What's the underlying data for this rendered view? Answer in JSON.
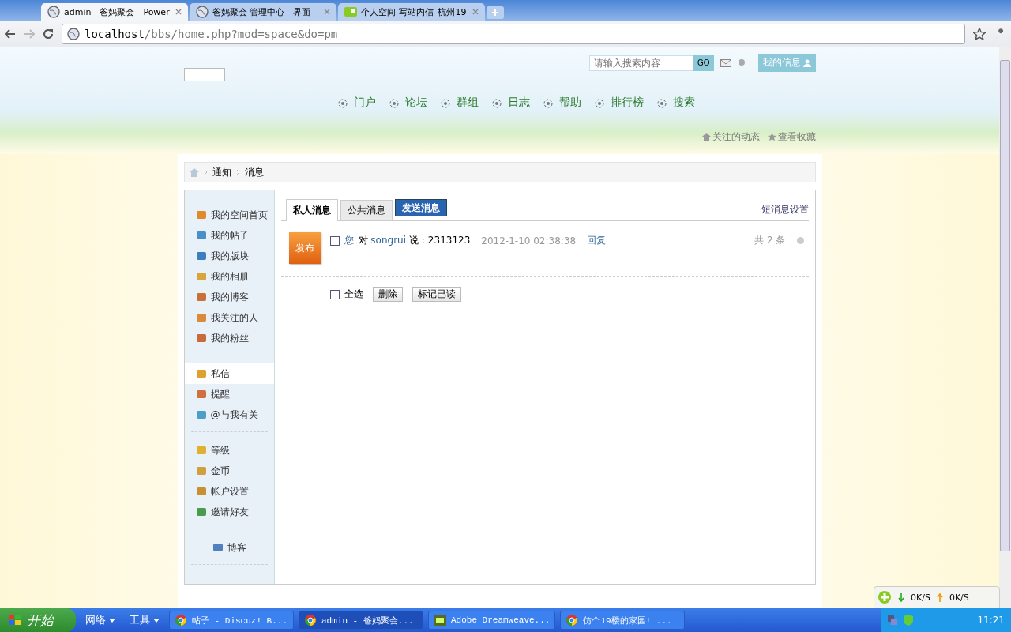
{
  "browser": {
    "tabs": [
      {
        "title": "admin - 爸妈聚会 - Power",
        "selected": true
      },
      {
        "title": "爸妈聚会 管理中心 - 界面",
        "selected": false
      },
      {
        "title": "个人空间-写站内信_杭州19",
        "selected": false
      }
    ],
    "url_host": "localhost",
    "url_path": "/bbs/home.php?mod=space&do=pm"
  },
  "header": {
    "search_placeholder": "请输入搜索内容",
    "go": "GO",
    "my_info": "我的信息",
    "nav": [
      "门户",
      "论坛",
      "群组",
      "日志",
      "帮助",
      "排行榜",
      "搜索"
    ],
    "links": [
      "关注的动态",
      "查看收藏"
    ]
  },
  "breadcrumb": [
    "通知",
    "消息"
  ],
  "sidebar": {
    "groups": [
      [
        {
          "label": "我的空间首页",
          "selected": false,
          "color": "#e08a2c"
        },
        {
          "label": "我的帖子",
          "selected": false,
          "color": "#4a90c8"
        },
        {
          "label": "我的版块",
          "selected": false,
          "color": "#3a7fc0"
        },
        {
          "label": "我的相册",
          "selected": false,
          "color": "#d9a53a"
        },
        {
          "label": "我的博客",
          "selected": false,
          "color": "#c8703a"
        },
        {
          "label": "我关注的人",
          "selected": false,
          "color": "#d98a3a"
        },
        {
          "label": "我的粉丝",
          "selected": false,
          "color": "#c86a3a"
        }
      ],
      [
        {
          "label": "私信",
          "selected": true,
          "color": "#e0a030"
        },
        {
          "label": "提醒",
          "selected": false,
          "color": "#d07040"
        },
        {
          "label": "@与我有关",
          "selected": false,
          "color": "#4aa0c8"
        }
      ],
      [
        {
          "label": "等级",
          "selected": false,
          "color": "#e0b030"
        },
        {
          "label": "金币",
          "selected": false,
          "color": "#d0a040"
        },
        {
          "label": "帐户设置",
          "selected": false,
          "color": "#c89030"
        },
        {
          "label": "邀请好友",
          "selected": false,
          "color": "#4a9a50"
        }
      ],
      [
        {
          "label": "博客",
          "selected": false,
          "color": "#5080c0"
        }
      ]
    ]
  },
  "tabs": [
    {
      "label": "私人消息",
      "selected": true
    },
    {
      "label": "公共消息",
      "selected": false
    }
  ],
  "send_button": "发送消息",
  "settings_link": "短消息设置",
  "messages": [
    {
      "avatar": "发布",
      "checked": false,
      "you": "您",
      "to": "对",
      "user": "songrui",
      "said": "说：2313123",
      "time": "2012-1-10 02:38:38",
      "reply": "回复",
      "count": "共 2 条"
    }
  ],
  "bulk": {
    "select_all": "全选",
    "checked": false,
    "buttons": [
      "删除",
      "标记已读"
    ]
  },
  "speed": {
    "down": "0K/S",
    "up": "0K/S"
  },
  "taskbar": {
    "start": "开始",
    "quick": [
      "网络",
      "工具"
    ],
    "tasks": [
      {
        "title": "帖子 - Discuz! B...",
        "selected": false,
        "kind": "chrome"
      },
      {
        "title": "admin - 爸妈聚会...",
        "selected": true,
        "kind": "chrome"
      },
      {
        "title": "Adobe Dreamweave...",
        "selected": false,
        "kind": "dw"
      },
      {
        "title": "仿个19楼的家园! ...",
        "selected": false,
        "kind": "chrome"
      }
    ],
    "time": "11:21"
  }
}
